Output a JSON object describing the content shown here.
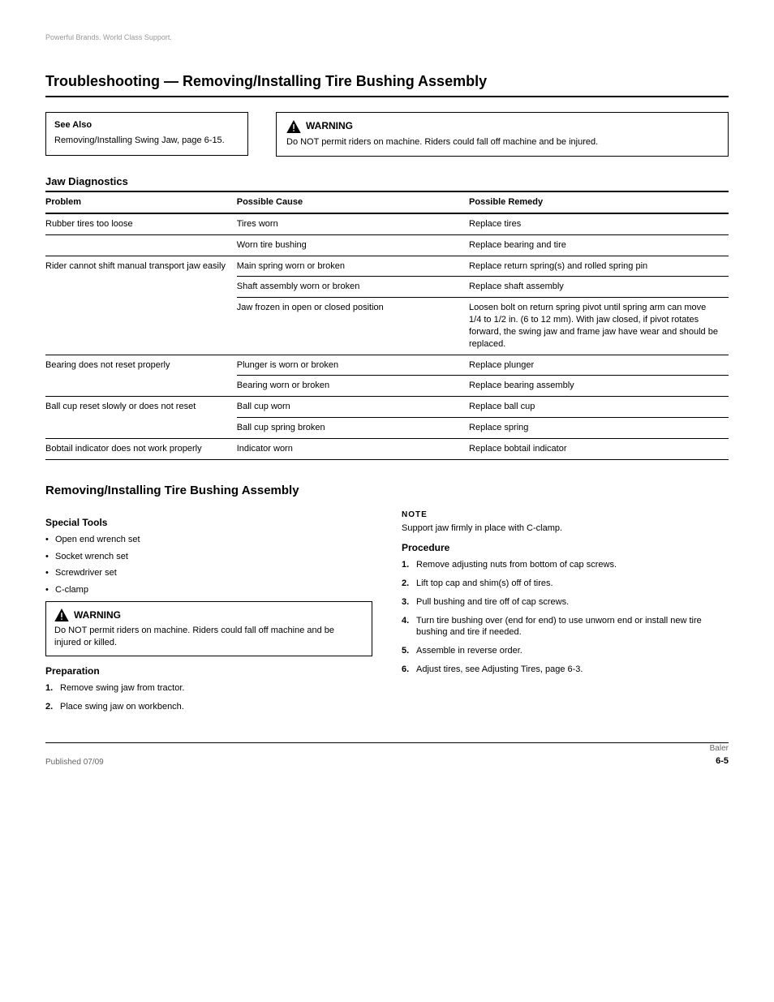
{
  "tagline": "Powerful Brands. World Class Support.",
  "header": {
    "section": "Troubleshooting",
    "title": "Removing/Installing Tire Bushing Assembly"
  },
  "see_also": {
    "title": "See Also",
    "text": "Removing/Installing Swing Jaw, page 6-15."
  },
  "warning": {
    "label": "WARNING",
    "body": "Do NOT permit riders on machine. Riders could fall off machine and be injured."
  },
  "diag_title": "Jaw Diagnostics",
  "diag_head": {
    "c1": "Problem",
    "c2": "Possible Cause",
    "c3": "Possible Remedy"
  },
  "diag_rows": [
    {
      "problem": "Rubber tires too loose",
      "cause": "Tires worn",
      "remedy": "Replace tires"
    },
    {
      "problem": "",
      "cause": "Worn tire bushing",
      "remedy": "Replace bearing and tire"
    },
    {
      "problem": "Rider cannot shift manual transport jaw easily",
      "cause": "Main spring worn or broken",
      "remedy": "Replace return spring(s) and rolled spring pin"
    },
    {
      "problem": "",
      "cause": "Shaft assembly worn or broken",
      "remedy": "Replace shaft assembly"
    },
    {
      "problem": "",
      "cause": "Jaw frozen in open or closed position",
      "remedy": "Loosen bolt on return spring pivot until spring arm can move 1/4 to 1/2 in. (6 to 12 mm). With jaw closed, if pivot rotates forward, the swing jaw and frame jaw have wear and should be replaced."
    },
    {
      "problem": "Bearing does not reset properly",
      "cause": "Plunger is worn or broken",
      "remedy": "Replace plunger"
    },
    {
      "problem": "",
      "cause": "Bearing worn or broken",
      "remedy": "Replace bearing assembly"
    },
    {
      "problem": "Ball cup reset slowly or does not reset",
      "cause": "Ball cup worn",
      "remedy": "Replace ball cup"
    },
    {
      "problem": "",
      "cause": "Ball cup spring broken",
      "remedy": "Replace spring"
    },
    {
      "problem": "Bobtail indicator does not work properly",
      "cause": "Indicator worn",
      "remedy": "Replace bobtail indicator"
    }
  ],
  "remove": {
    "title": "Removing/Installing Tire Bushing Assembly",
    "special_tools_head": "Special Tools",
    "special_tools": [
      "Open end wrench set",
      "Socket wrench set",
      "Screwdriver set",
      "C-clamp"
    ],
    "warning": {
      "label": "WARNING",
      "body": "Do NOT permit riders on machine. Riders could fall off machine and be injured or killed."
    },
    "prep_head": "Preparation",
    "prep_steps": [
      "Remove swing jaw from tractor.",
      "Place swing jaw on workbench."
    ],
    "note_label": "NOTE",
    "note_body": "Support jaw firmly in place with C-clamp.",
    "procedure_head": "Procedure",
    "proc_steps": [
      "Remove adjusting nuts from bottom of cap screws.",
      "Lift top cap and shim(s) off of tires.",
      "Pull bushing and tire off of cap screws.",
      "Turn tire bushing over (end for end) to use unworn end or install new tire bushing and tire if needed.",
      "Assemble in reverse order.",
      "Adjust tires, see Adjusting Tires, page 6-3."
    ]
  },
  "footer": {
    "pub": "Published 07/09",
    "page_label": "Baler",
    "page_num": "6-5"
  }
}
